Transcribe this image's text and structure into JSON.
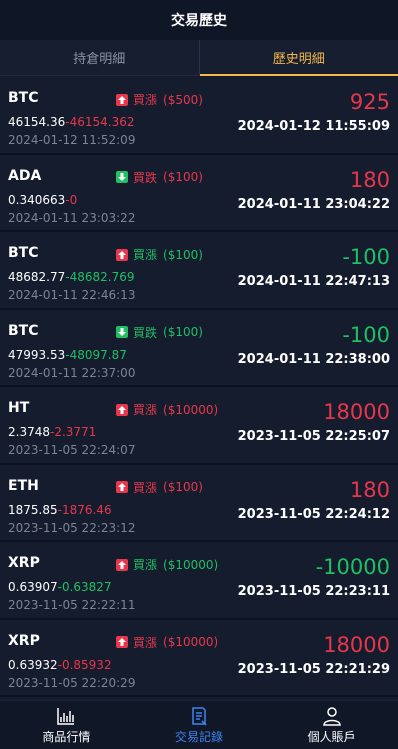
{
  "header": {
    "title": "交易歷史"
  },
  "tabs": [
    {
      "label": "持倉明細"
    },
    {
      "label": "歷史明細"
    }
  ],
  "colors": {
    "up": "#e8374c",
    "down": "#1fbf62",
    "accent": "#f2b84a",
    "nav_active": "#3d82f0"
  },
  "records": [
    {
      "coin": "BTC",
      "direction": "買漲",
      "dir_icon": "up-arrow-icon",
      "dir_color": "red",
      "amount": "($500)",
      "open": "46154.36",
      "close": "-46154.362",
      "close_color": "red",
      "open_time": "2024-01-12 11:52:09",
      "profit": "925",
      "profit_color": "red",
      "close_time": "2024-01-12 11:55:09"
    },
    {
      "coin": "ADA",
      "direction": "買跌",
      "dir_icon": "down-arrow-icon",
      "dir_color": "red",
      "amount": "($100)",
      "open": "0.340663",
      "close": "-0",
      "close_color": "red",
      "open_time": "2024-01-11 23:03:22",
      "profit": "180",
      "profit_color": "red",
      "close_time": "2024-01-11 23:04:22"
    },
    {
      "coin": "BTC",
      "direction": "買漲",
      "dir_icon": "up-arrow-icon",
      "dir_color": "green",
      "amount": "($100)",
      "open": "48682.77",
      "close": "-48682.769",
      "close_color": "green",
      "open_time": "2024-01-11 22:46:13",
      "profit": "-100",
      "profit_color": "green",
      "close_time": "2024-01-11 22:47:13"
    },
    {
      "coin": "BTC",
      "direction": "買跌",
      "dir_icon": "down-arrow-icon",
      "dir_color": "green",
      "amount": "($100)",
      "open": "47993.53",
      "close": "-48097.87",
      "close_color": "green",
      "open_time": "2024-01-11 22:37:00",
      "profit": "-100",
      "profit_color": "green",
      "close_time": "2024-01-11 22:38:00"
    },
    {
      "coin": "HT",
      "direction": "買漲",
      "dir_icon": "up-arrow-icon",
      "dir_color": "red",
      "amount": "($10000)",
      "open": "2.3748",
      "close": "-2.3771",
      "close_color": "red",
      "open_time": "2023-11-05 22:24:07",
      "profit": "18000",
      "profit_color": "red",
      "close_time": "2023-11-05 22:25:07"
    },
    {
      "coin": "ETH",
      "direction": "買漲",
      "dir_icon": "up-arrow-icon",
      "dir_color": "red",
      "amount": "($100)",
      "open": "1875.85",
      "close": "-1876.46",
      "close_color": "red",
      "open_time": "2023-11-05 22:23:12",
      "profit": "180",
      "profit_color": "red",
      "close_time": "2023-11-05 22:24:12"
    },
    {
      "coin": "XRP",
      "direction": "買漲",
      "dir_icon": "up-arrow-icon",
      "dir_color": "green",
      "amount": "($10000)",
      "open": "0.63907",
      "close": "-0.63827",
      "close_color": "green",
      "open_time": "2023-11-05 22:22:11",
      "profit": "-10000",
      "profit_color": "green",
      "close_time": "2023-11-05 22:23:11"
    },
    {
      "coin": "XRP",
      "direction": "買漲",
      "dir_icon": "up-arrow-icon",
      "dir_color": "red",
      "amount": "($10000)",
      "open": "0.63932",
      "close": "-0.85932",
      "close_color": "red",
      "open_time": "2023-11-05 22:20:29",
      "profit": "18000",
      "profit_color": "red",
      "close_time": "2023-11-05 22:21:29"
    }
  ],
  "bottom_nav": [
    {
      "label": "商品行情",
      "icon": "chart-icon"
    },
    {
      "label": "交易記錄",
      "icon": "document-icon"
    },
    {
      "label": "個人賬戶",
      "icon": "user-icon"
    }
  ]
}
